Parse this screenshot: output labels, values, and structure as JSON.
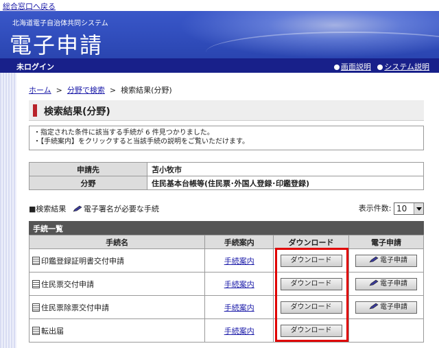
{
  "top_link": "総合窓口へ戻る",
  "banner": {
    "subtitle": "北海道電子自治体共同システム",
    "title": "電子申請"
  },
  "status": {
    "login": "未ログイン",
    "screen_help": "画面説明",
    "system_help": "システム説明"
  },
  "breadcrumb": {
    "home": "ホーム",
    "sep1": ">",
    "category": "分野で検索",
    "sep2": ">",
    "current": "検索結果(分野)"
  },
  "heading": "検索結果(分野)",
  "notes": [
    "・指定された条件に該当する手続が 6 件見つかりました。",
    "・【手続案内】をクリックすると当該手続の説明をご覧いただけます。"
  ],
  "info": {
    "destination_label": "申請先",
    "destination_value": "苫小牧市",
    "field_label": "分野",
    "field_value": "住民基本台帳等(住民票･外国人登録･印鑑登録)"
  },
  "legend": {
    "results": "■検索結果",
    "signature": "電子署名が必要な手続"
  },
  "per_page": {
    "label": "表示件数:",
    "value": "10"
  },
  "list_title": "手続一覧",
  "table": {
    "headers": [
      "手続名",
      "手続案内",
      "ダウンロード",
      "電子申請"
    ],
    "guide_label": "手続案内",
    "download_label": "ダウンロード",
    "apply_label": "電子申請",
    "rows": [
      {
        "name": "印鑑登録証明書交付申請",
        "apply": true
      },
      {
        "name": "住民票交付申請",
        "apply": true
      },
      {
        "name": "住民票除票交付申請",
        "apply": true
      },
      {
        "name": "転出届",
        "apply": false
      }
    ]
  },
  "colors": {
    "banner": "#3350c0",
    "status_bar": "#18208a",
    "accent_red": "#b8232a",
    "highlight": "#e00000"
  }
}
